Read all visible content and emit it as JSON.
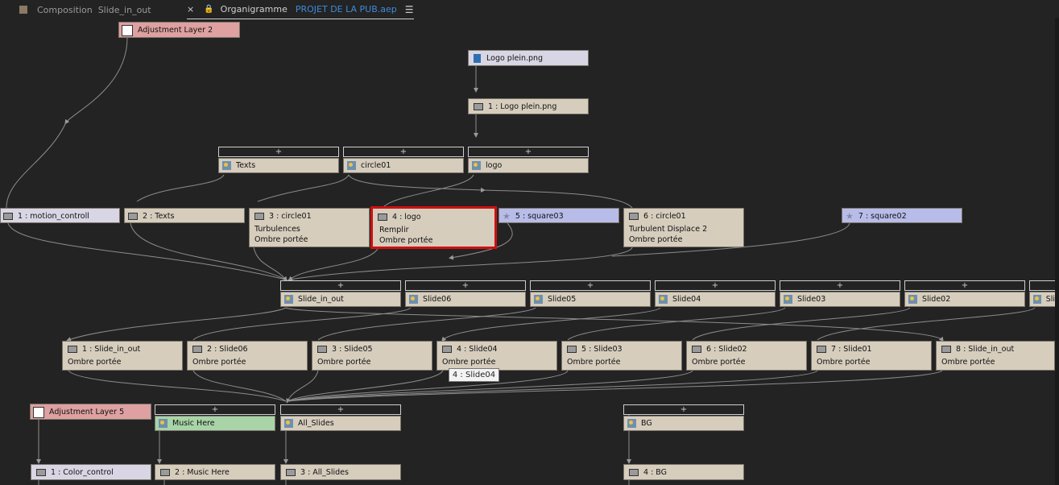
{
  "tabs": [
    {
      "label": "Composition",
      "comp": "Slide_in_out"
    },
    {
      "label": "Organigramme",
      "project": "PROJET DE LA PUB.aep"
    }
  ],
  "icons": {
    "tab_square": "composition-square-icon",
    "close": "×",
    "lock": "lock-icon",
    "menu": "☰",
    "plus": "+",
    "star": "★"
  },
  "colors": {
    "background": "#232323",
    "layer_node": "#d6cdbd",
    "adjustment_node": "#dea0a0",
    "footage_node": "#d8d6e4",
    "shape_node": "#b8bce8",
    "audio_node": "#a8d4a8",
    "selection": "#d01010",
    "project_name": "#3f8ad8"
  },
  "nodes": {
    "adjustment_layer_2": "Adjustment Layer 2",
    "logo_plein_png": "Logo plein.png",
    "layer_1_logo_plein": "1 : Logo plein.png",
    "pre_texts": "Texts",
    "pre_circle01": "circle01",
    "pre_logo": "logo",
    "layer_1_motion": "1 : motion_controll",
    "layer_2_texts": "2 : Texts",
    "layer_3_circle01": {
      "title": "3 : circle01",
      "effects": [
        "Turbulences",
        "Ombre portée"
      ]
    },
    "layer_4_logo": {
      "title": "4 : logo",
      "effects": [
        "Remplir",
        "Ombre portée"
      ]
    },
    "layer_5_square03": "5 : square03",
    "layer_6_circle01": {
      "title": "6 : circle01",
      "effects": [
        "Turbulent Displace 2",
        "Ombre portée"
      ]
    },
    "layer_7_square02": "7 : square02",
    "pre_slide_in_out": "Slide_in_out",
    "pre_slide06": "Slide06",
    "pre_slide05": "Slide05",
    "pre_slide04": "Slide04",
    "pre_slide03": "Slide03",
    "pre_slide02": "Slide02",
    "pre_sli_cut": "Sli",
    "slide_layers": [
      {
        "title": "1 : Slide_in_out",
        "effect": "Ombre portée"
      },
      {
        "title": "2 : Slide06",
        "effect": "Ombre portée"
      },
      {
        "title": "3 : Slide05",
        "effect": "Ombre portée"
      },
      {
        "title": "4 : Slide04",
        "effect": "Ombre portée"
      },
      {
        "title": "5 : Slide03",
        "effect": "Ombre portée"
      },
      {
        "title": "6 : Slide02",
        "effect": "Ombre portée"
      },
      {
        "title": "7 : Slide01",
        "effect": "Ombre portée"
      },
      {
        "title": "8 : Slide_in_out",
        "effect": "Ombre portée"
      }
    ],
    "adjustment_layer_5": "Adjustment Layer 5",
    "pre_music": "Music Here",
    "pre_all_slides": "All_Slides",
    "pre_bg": "BG",
    "layer_1_color": "1 : Color_control",
    "layer_2_music": "2 : Music Here",
    "layer_3_all_slides": "3 : All_Slides",
    "layer_4_bg": "4 : BG"
  },
  "tooltip": "4 : Slide04"
}
